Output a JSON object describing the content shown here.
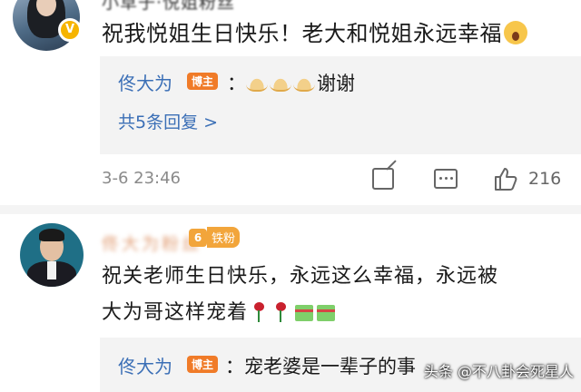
{
  "comment1": {
    "author_name": "小草子·悦姐粉丝",
    "text": "祝我悦姐生日快乐！老大和悦姐永远幸福",
    "reply": {
      "name": "佟大为",
      "badge": "博主",
      "text": "：🙏🙏🙏谢谢",
      "text_after_emoji": "谢谢",
      "more": "共5条回复 >"
    },
    "timestamp": "3-6 23:46",
    "likes": "216"
  },
  "comment2": {
    "author_name": "佟大为粉丝",
    "fan_level": "6",
    "fan_badge": "铁粉",
    "line1": "祝关老师生日快乐，永远这么幸福，永远被",
    "line2": "大为哥这样宠着",
    "reply": {
      "name": "佟大为",
      "badge": "博主",
      "text": "：宠老婆是一辈子的事"
    }
  },
  "watermark": "头条 @不八卦会死星人"
}
